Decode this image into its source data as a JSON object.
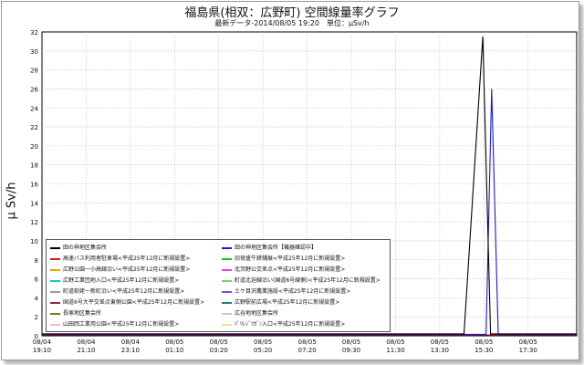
{
  "chart_data": {
    "type": "line",
    "title": "福島県(相双：広野町) 空間線量率グラフ",
    "subtitle": "最新データ-2014/08/05 19:20　単位：μSv/h",
    "ylabel": "μ Sv/h",
    "xlabel": "",
    "ylim": [
      0,
      32
    ],
    "yticks": [
      0,
      2,
      4,
      6,
      8,
      10,
      12,
      14,
      16,
      18,
      20,
      22,
      24,
      26,
      28,
      30,
      32
    ],
    "xticks": [
      {
        "date": "08/04",
        "time": "19:10"
      },
      {
        "date": "08/04",
        "time": "21:10"
      },
      {
        "date": "08/04",
        "time": "23:10"
      },
      {
        "date": "08/05",
        "time": "01:10"
      },
      {
        "date": "08/05",
        "time": "03:20"
      },
      {
        "date": "08/05",
        "time": "05:20"
      },
      {
        "date": "08/05",
        "time": "07:20"
      },
      {
        "date": "08/05",
        "time": "09:30"
      },
      {
        "date": "08/05",
        "time": "11:30"
      },
      {
        "date": "08/05",
        "time": "13:30"
      },
      {
        "date": "08/05",
        "time": "15:30"
      },
      {
        "date": "08/05",
        "time": "17:30"
      }
    ],
    "x_range_hours": [
      0,
      24.2
    ],
    "grid": true,
    "legend_position": "bottom-left",
    "series": [
      {
        "name": "田の神地区集会所",
        "color": "#000000",
        "points": [
          [
            0,
            0.2
          ],
          [
            19.1,
            0.2
          ],
          [
            19.95,
            31.5
          ],
          [
            20.3,
            0.2
          ],
          [
            24.2,
            0.2
          ]
        ]
      },
      {
        "name": "田の神地区集会所【機器確認中】",
        "color": "#1a1acc",
        "points": [
          [
            0,
            0.15
          ],
          [
            20.1,
            0.15
          ],
          [
            20.35,
            26
          ],
          [
            20.65,
            0.15
          ],
          [
            24.2,
            0.15
          ]
        ]
      },
      {
        "name": "高速バス利用者駐車場<平成25年12月に新規設置>",
        "color": "#d11a1a",
        "points": [
          [
            0,
            0.1
          ],
          [
            24.2,
            0.1
          ]
        ]
      },
      {
        "name": "旧夜盛牛耕舗展<平成25年12月に新規設置>",
        "color": "#1bbf1b",
        "points": [
          [
            0,
            0.1
          ],
          [
            24.2,
            0.1
          ]
        ]
      },
      {
        "name": "広野公園一小高線沿い<平成25年12月に新規設置>",
        "color": "#e6a600",
        "points": [
          [
            0,
            0.1
          ],
          [
            24.2,
            0.1
          ]
        ]
      },
      {
        "name": "北茨野公交差点<平成25年12月に新規設置>",
        "color": "#e040e0",
        "points": [
          [
            0,
            0.1
          ],
          [
            24.2,
            0.1
          ]
        ]
      },
      {
        "name": "広野工業団地入口<平成25年12月に新規設置>",
        "color": "#17c2d0",
        "points": [
          [
            0,
            0.1
          ],
          [
            24.2,
            0.1
          ]
        ]
      },
      {
        "name": "町道北迫線沿い(国道6号線側)<平成25年12月に新規設置>",
        "color": "#66d96b",
        "points": [
          [
            0,
            0.1
          ],
          [
            24.2,
            0.1
          ]
        ]
      },
      {
        "name": "町道萩姥一新町沿い<平成25年12月に新規設置>",
        "color": "#9a9a9a",
        "points": [
          [
            0,
            0.1
          ],
          [
            24.2,
            0.1
          ]
        ]
      },
      {
        "name": "土ケ目沢農業施設<平成25年12月に新規設置>",
        "color": "#7b4fc7",
        "points": [
          [
            0,
            0.1
          ],
          [
            24.2,
            0.1
          ]
        ]
      },
      {
        "name": "国道6号大平交差点東側公園<平成25年12月に新規設置>",
        "color": "#8e2a4c",
        "points": [
          [
            0,
            0.1
          ],
          [
            24.2,
            0.1
          ]
        ]
      },
      {
        "name": "広野駅前広場<平成25年12月に新規設置>",
        "color": "#1f7d7d",
        "points": [
          [
            0,
            0.1
          ],
          [
            24.2,
            0.1
          ]
        ]
      },
      {
        "name": "長塚地区集会所",
        "color": "#7a7a1a",
        "points": [
          [
            0,
            0.1
          ],
          [
            24.2,
            0.1
          ]
        ]
      },
      {
        "name": "広谷地地区集会所",
        "color": "#c9c9c9",
        "points": [
          [
            0,
            0.1
          ],
          [
            24.2,
            0.1
          ]
        ]
      },
      {
        "name": "山田岡工業用公園<平成25年12月に新規設置>",
        "color": "#f2b8e8",
        "points": [
          [
            0,
            0.1
          ],
          [
            24.2,
            0.1
          ]
        ]
      },
      {
        "name": "ﾊﾟﾘﾚｼﾞﾂｶﾞﾝ入口<平成25年12月に新規設置>",
        "color": "#f2e08a",
        "points": [
          [
            0,
            0.1
          ],
          [
            24.2,
            0.1
          ]
        ]
      }
    ]
  }
}
